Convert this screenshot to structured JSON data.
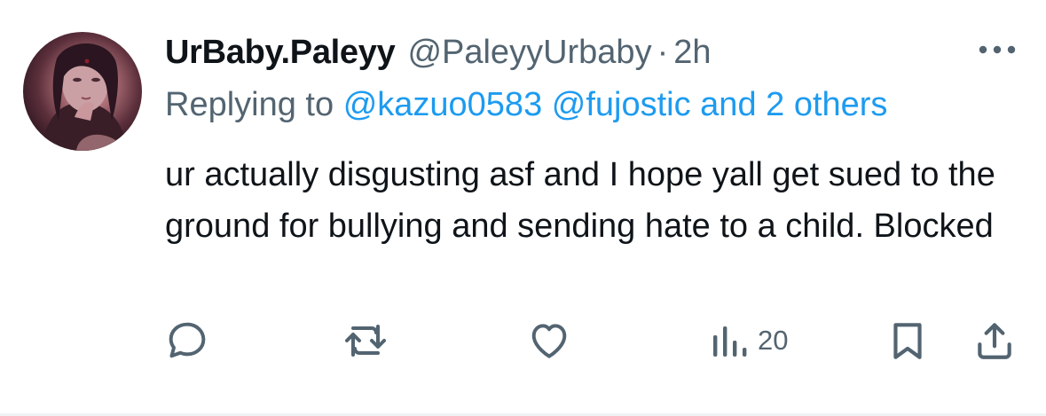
{
  "tweet": {
    "display_name": "UrBaby.Paleyy",
    "handle": "@PaleyyUrbaby",
    "separator": "·",
    "time": "2h",
    "replying_to_label": "Replying to",
    "mention_1": "@kazuo0583",
    "mention_2": "@fujostic",
    "mention_others": "and 2 others",
    "text": "ur actually disgusting asf and I hope yall get sued to the ground for bullying and sending hate to a child. Blocked",
    "views_count": "20"
  },
  "icons": {
    "avatar": "avatar-image",
    "more": "more-icon",
    "reply": "reply-icon",
    "retweet": "retweet-icon",
    "like": "like-icon",
    "views": "views-icon",
    "bookmark": "bookmark-icon",
    "share": "share-icon"
  },
  "colors": {
    "text_primary": "#0f1419",
    "text_secondary": "#536471",
    "link": "#1d9bf0",
    "background": "#ffffff"
  }
}
